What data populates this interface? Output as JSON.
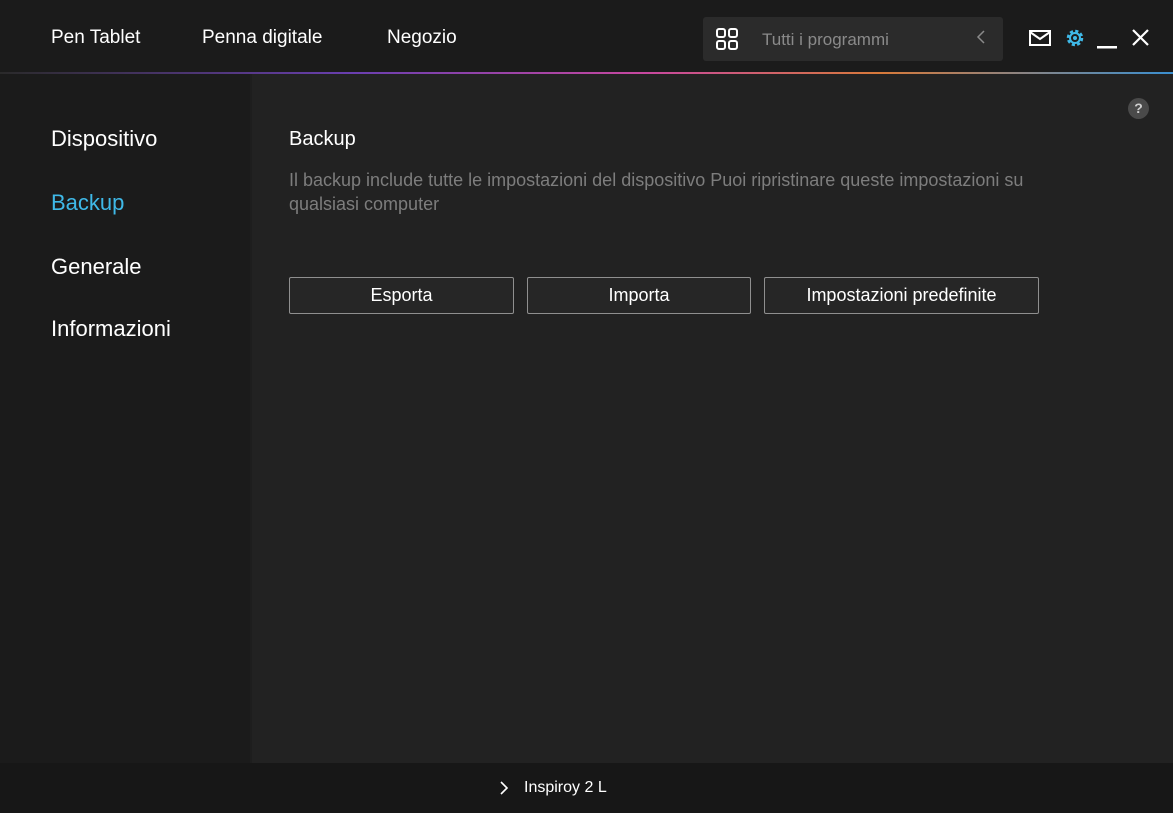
{
  "topbar": {
    "nav": [
      {
        "label": "Pen Tablet"
      },
      {
        "label": "Penna digitale"
      },
      {
        "label": "Negozio"
      }
    ],
    "program_selector": {
      "label": "Tutti i programmi",
      "icon": "grid-icon",
      "back_icon": "chevron-left-icon"
    },
    "window_icons": [
      "mail-icon",
      "gear-icon",
      "minimize-icon",
      "close-icon"
    ],
    "accent_color": "#3fb9e8",
    "gear_color": "#3fb9e8"
  },
  "sidebar": {
    "items": [
      {
        "label": "Dispositivo",
        "active": false
      },
      {
        "label": "Backup",
        "active": true
      },
      {
        "label": "Generale",
        "active": false
      },
      {
        "label": "Informazioni",
        "active": false
      }
    ]
  },
  "main": {
    "help_label": "?",
    "title": "Backup",
    "description": "Il backup include tutte le impostazioni del dispositivo Puoi ripristinare queste impostazioni su qualsiasi computer",
    "buttons": {
      "export": "Esporta",
      "import": "Importa",
      "defaults": "Impostazioni predefinite"
    }
  },
  "footer": {
    "device_label": "Inspiroy 2 L",
    "icon": "chevron-right-icon"
  }
}
